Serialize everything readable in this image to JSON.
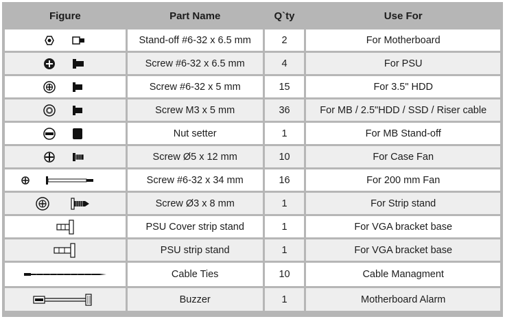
{
  "headers": {
    "figure": "Figure",
    "part_name": "Part Name",
    "qty": "Q`ty",
    "use_for": "Use For"
  },
  "rows": [
    {
      "part": "Stand-off #6-32 x 6.5 mm",
      "qty": "2",
      "use": "For Motherboard",
      "icon": "standoff-icon"
    },
    {
      "part": "Screw #6-32 x 6.5 mm",
      "qty": "4",
      "use": "For PSU",
      "icon": "psu-screw-icon"
    },
    {
      "part": "Screw #6-32 x 5 mm",
      "qty": "15",
      "use": "For 3.5\" HDD",
      "icon": "hdd-screw-icon"
    },
    {
      "part": "Screw M3 x 5 mm",
      "qty": "36",
      "use": "For MB / 2.5\"HDD / SSD / Riser cable",
      "icon": "m3-screw-icon"
    },
    {
      "part": "Nut setter",
      "qty": "1",
      "use": "For MB Stand-off",
      "icon": "nut-setter-icon"
    },
    {
      "part": "Screw  Ø5  x  12  mm",
      "qty": "10",
      "use": "For Case Fan",
      "icon": "fan-screw-icon"
    },
    {
      "part": "Screw #6-32 x 34 mm",
      "qty": "16",
      "use": "For 200 mm Fan",
      "icon": "long-screw-icon"
    },
    {
      "part": "Screw  Ø3  x  8  mm",
      "qty": "1",
      "use": "For Strip stand",
      "icon": "strip-screw-icon"
    },
    {
      "part": "PSU Cover strip stand",
      "qty": "1",
      "use": "For VGA bracket base",
      "icon": "cover-strip-stand-icon"
    },
    {
      "part": "PSU strip stand",
      "qty": "1",
      "use": "For VGA bracket base",
      "icon": "strip-stand-icon"
    },
    {
      "part": "Cable Ties",
      "qty": "10",
      "use": "Cable Managment",
      "icon": "cable-tie-icon"
    },
    {
      "part": "Buzzer",
      "qty": "1",
      "use": "Motherboard Alarm",
      "icon": "buzzer-icon"
    }
  ]
}
